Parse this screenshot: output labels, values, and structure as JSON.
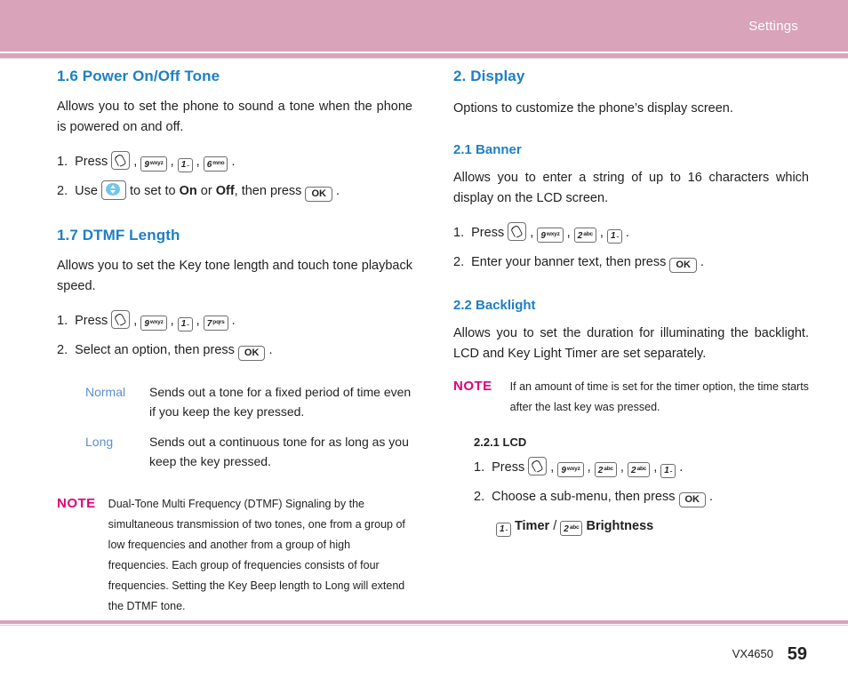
{
  "header": {
    "title": "Settings"
  },
  "footer": {
    "model": "VX4650",
    "page": "59"
  },
  "left": {
    "s16": {
      "heading": "1.6 Power On/Off Tone",
      "intro": "Allows you to set the phone to sound a tone when the phone is powered on and off.",
      "step1_label": "1.",
      "step1_press": "Press",
      "step2_label": "2.",
      "step2_use": "Use",
      "step2_mid": "to set to",
      "step2_on": "On",
      "step2_or": "or",
      "step2_off": "Off",
      "step2_then": ", then press",
      "keys": [
        {
          "digit": "9",
          "letters": "wxyz"
        },
        {
          "digit": "1",
          "letters": "dots"
        },
        {
          "digit": "6",
          "letters": "mno"
        }
      ],
      "ok_label": "OK"
    },
    "s17": {
      "heading": "1.7 DTMF Length",
      "intro": "Allows you to set the Key tone length and touch tone playback speed.",
      "step1_label": "1.",
      "step1_press": "Press",
      "step2_label": "2.",
      "step2_text": "Select an option, then press",
      "keys": [
        {
          "digit": "9",
          "letters": "wxyz"
        },
        {
          "digit": "1",
          "letters": "dots"
        },
        {
          "digit": "7",
          "letters": "pqrs"
        }
      ],
      "ok_label": "OK",
      "options": [
        {
          "name": "Normal",
          "desc": "Sends out a tone for a fixed period of time even if you keep the key pressed."
        },
        {
          "name": "Long",
          "desc": "Sends out a continuous tone for as long as you keep the key pressed."
        }
      ]
    },
    "note": {
      "label": "NOTE",
      "text": "Dual-Tone Multi Frequency (DTMF) Signaling by the simultaneous transmission of two tones, one from a group of low frequencies and another from a group of high frequencies. Each group of frequencies consists of four frequencies. Setting the Key Beep length to Long will extend the DTMF tone."
    }
  },
  "right": {
    "s2": {
      "heading": "2. Display",
      "intro": "Options to customize the phone’s display screen."
    },
    "s21": {
      "heading": "2.1 Banner",
      "intro": "Allows you to enter a string of up to 16 characters which display on the LCD screen.",
      "step1_label": "1.",
      "step1_press": "Press",
      "step2_label": "2.",
      "step2_text": "Enter your banner text, then press",
      "keys": [
        {
          "digit": "9",
          "letters": "wxyz"
        },
        {
          "digit": "2",
          "letters": "abc"
        },
        {
          "digit": "1",
          "letters": "dots"
        }
      ],
      "ok_label": "OK"
    },
    "s22": {
      "heading": "2.2 Backlight",
      "intro": "Allows you to set the duration for illuminating the backlight. LCD and Key Light Timer are set separately.",
      "note": {
        "label": "NOTE",
        "text": "If an amount of time is set for the timer option, the time starts after the last key was pressed."
      },
      "sub": {
        "heading": "2.2.1 LCD",
        "step1_label": "1.",
        "step1_press": "Press",
        "keys": [
          {
            "digit": "9",
            "letters": "wxyz"
          },
          {
            "digit": "2",
            "letters": "abc"
          },
          {
            "digit": "2",
            "letters": "abc"
          },
          {
            "digit": "1",
            "letters": "dots"
          }
        ],
        "step2_label": "2.",
        "step2_text": "Choose a sub-menu, then press",
        "ok_label": "OK",
        "tail_key1": {
          "digit": "1",
          "letters": "dots"
        },
        "tail_label1": "Timer",
        "tail_sep": "/",
        "tail_key2": {
          "digit": "2",
          "letters": "abc"
        },
        "tail_label2": "Brightness"
      }
    }
  }
}
